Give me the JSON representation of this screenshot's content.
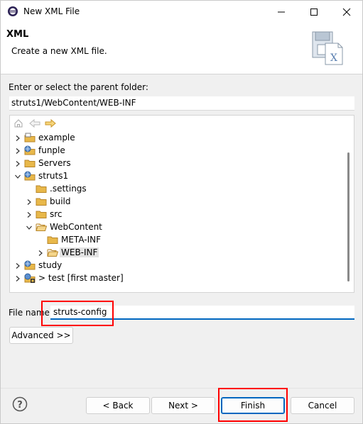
{
  "window": {
    "title": "New XML File"
  },
  "header": {
    "title": "XML",
    "description": "Create a new XML file."
  },
  "parent_folder": {
    "label": "Enter or select the parent folder:",
    "value": "struts1/WebContent/WEB-INF"
  },
  "tree": {
    "toolbar": [
      "home-icon",
      "back-arrow-icon",
      "forward-arrow-icon"
    ],
    "items": [
      {
        "label": "example",
        "expanded": false,
        "icon": "project-icon"
      },
      {
        "label": "funple",
        "expanded": false,
        "icon": "web-project-icon"
      },
      {
        "label": "Servers",
        "expanded": false,
        "icon": "folder-icon"
      },
      {
        "label": "struts1",
        "expanded": true,
        "icon": "web-project-icon"
      },
      {
        "label": ".settings",
        "expanded": false,
        "icon": "folder-icon"
      },
      {
        "label": "build",
        "expanded": false,
        "icon": "folder-icon"
      },
      {
        "label": "src",
        "expanded": false,
        "icon": "folder-icon"
      },
      {
        "label": "WebContent",
        "expanded": true,
        "icon": "folder-open-icon"
      },
      {
        "label": "META-INF",
        "expanded": false,
        "icon": "folder-icon"
      },
      {
        "label": "WEB-INF",
        "expanded": false,
        "icon": "folder-open-icon",
        "selected": true
      },
      {
        "label": "study",
        "expanded": false,
        "icon": "web-project-icon"
      },
      {
        "label": "> test [first master]",
        "expanded": false,
        "icon": "git-project-icon"
      }
    ]
  },
  "file_name": {
    "label": "File name:",
    "value": "struts-config"
  },
  "buttons": {
    "advanced": "Advanced >>",
    "back": "< Back",
    "next": "Next >",
    "finish": "Finish",
    "cancel": "Cancel",
    "help": "?"
  },
  "colors": {
    "accent": "#0067c0",
    "highlight": "#ff0000",
    "folder": "#e8b84a"
  }
}
